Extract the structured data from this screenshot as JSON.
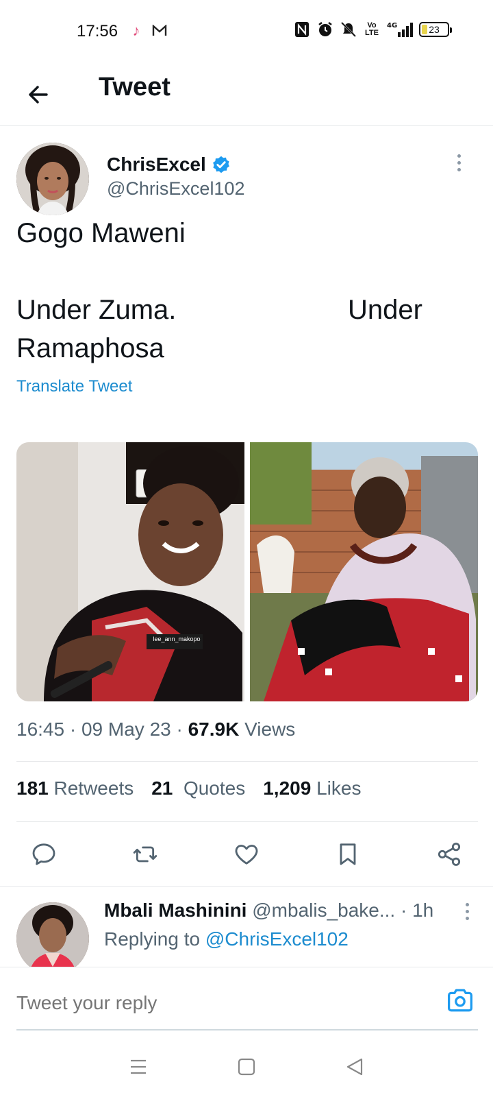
{
  "status_bar": {
    "time": "17:56",
    "battery": "23",
    "battery_level": 0.23,
    "network": "4G"
  },
  "header": {
    "title": "Tweet"
  },
  "tweet": {
    "author_name": "ChrisExcel",
    "author_handle": "@ChrisExcel102",
    "verified": true,
    "text_lines": [
      "Gogo Maweni",
      "Under Zuma.",
      "Under",
      "Ramaphosa"
    ],
    "translate_label": "Translate Tweet",
    "media_captions": [
      "lee_ann_makopo",
      ""
    ],
    "time": "16:45",
    "date": "09 May 23",
    "views_count": "67.9K",
    "views_label": "Views",
    "separator": "·"
  },
  "stats": {
    "retweets_count": "181",
    "retweets_label": "Retweets",
    "quotes_count": "21",
    "quotes_label": "Quotes",
    "likes_count": "1,209",
    "likes_label": "Likes"
  },
  "actions": [
    "reply-icon",
    "retweet-icon",
    "like-icon",
    "bookmark-icon",
    "share-icon"
  ],
  "reply": {
    "author_name": "Mbali Mashinini",
    "author_handle": "@mbalis_bake...",
    "age": "1h",
    "replying_prefix": "Replying to",
    "replying_to": "@ChrisExcel102"
  },
  "composer": {
    "placeholder": "Tweet your reply"
  },
  "colors": {
    "accent": "#1d9bf0",
    "link": "#1d8ccf",
    "secondary_text": "#536471"
  }
}
